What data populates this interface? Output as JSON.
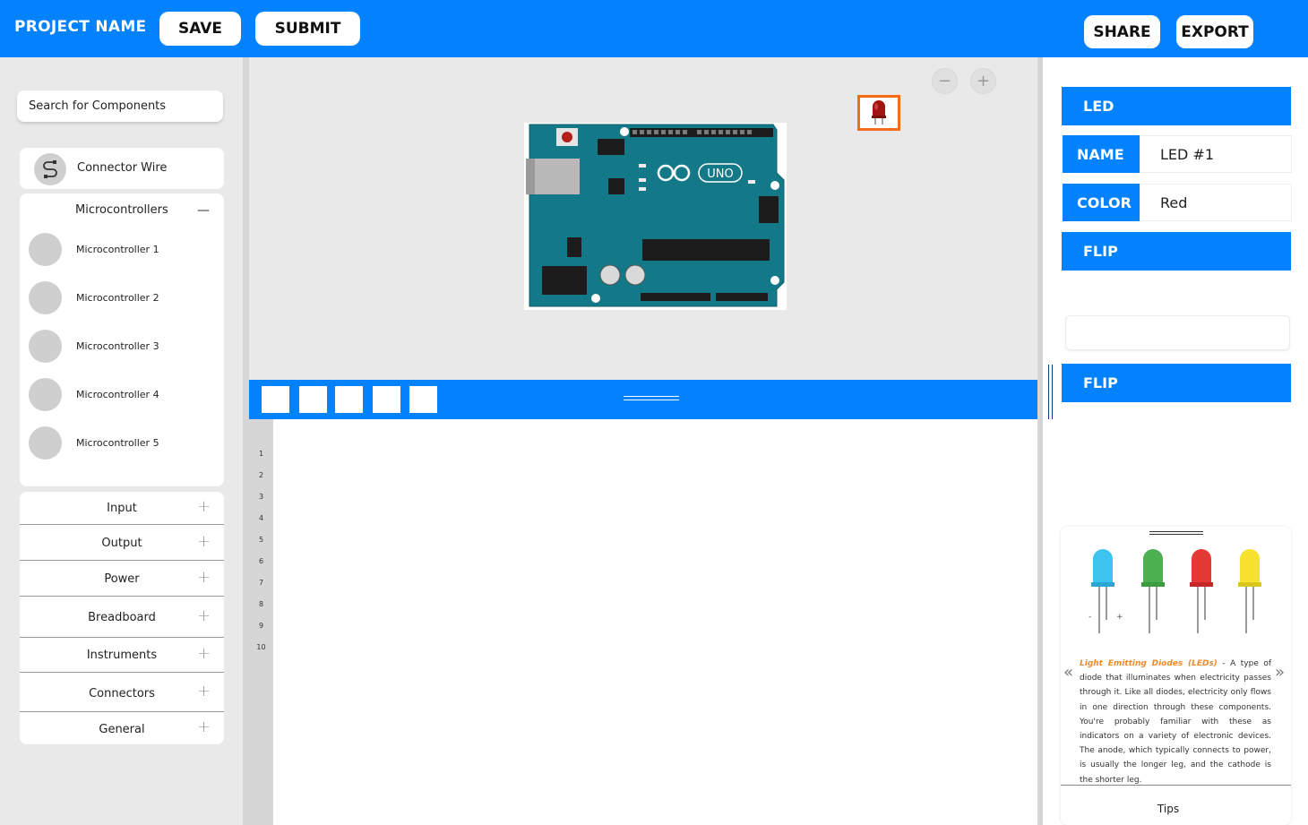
{
  "header": {
    "project_name": "PROJECT NAME",
    "save_label": "SAVE",
    "submit_label": "SUBMIT",
    "share_label": "SHARE",
    "export_label": "EXPORT"
  },
  "sidebar": {
    "search_placeholder": "Search for Components",
    "connector_wire": "Connector Wire",
    "microcontrollers": {
      "title": "Microcontrollers",
      "collapse_symbol": "—",
      "items": [
        "Microcontroller 1",
        "Microcontroller 2",
        "Microcontroller 3",
        "Microcontroller 4",
        "Microcontroller 5"
      ]
    },
    "categories": [
      "Input",
      "Output",
      "Power",
      "Breadboard",
      "Instruments",
      "Connectors",
      "General"
    ],
    "expand_symbol": "+"
  },
  "canvas": {
    "zoom_out_symbol": "−",
    "zoom_in_symbol": "+"
  },
  "code_editor": {
    "line_numbers": [
      "1",
      "2",
      "3",
      "4",
      "5",
      "6",
      "7",
      "8",
      "9",
      "10"
    ]
  },
  "properties": {
    "component_title": "LED",
    "name_label": "NAME",
    "name_value": "LED #1",
    "color_label": "COLOR",
    "color_value": "Red",
    "flip_label": "FLIP",
    "flip2_label": "FLIP"
  },
  "info": {
    "term": "Light Emitting Diodes (LEDs)",
    "description": " - A type of diode that illuminates when electricity passes through it. Like all diodes, electricity only flows in one direction through these components. You're probably familiar with these as indicators on a variety of electronic devices. The anode, which typically connects to power, is usually the longer leg, and the cathode is the shorter leg.",
    "prev_symbol": "«",
    "next_symbol": "»",
    "minus_sign": "-",
    "plus_sign": "+",
    "tips_label": "Tips",
    "led_colors": [
      "#3ec4f0",
      "#4caf50",
      "#e53935",
      "#f5e12e"
    ]
  },
  "colors": {
    "brand_blue": "#0282fe",
    "selection_orange": "#f36b1b"
  }
}
